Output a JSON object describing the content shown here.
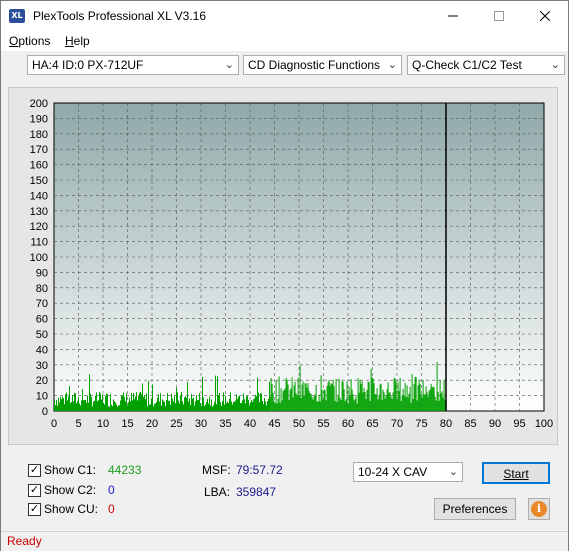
{
  "window": {
    "title": "PlexTools Professional XL V3.16",
    "icon_text": "XL",
    "minimize_icon": "minimize-icon",
    "maximize_icon": "maximize-icon",
    "close_icon": "close-icon"
  },
  "menu": {
    "options_prefix": "O",
    "options_rest": "ptions",
    "help_prefix": "H",
    "help_rest": "elp"
  },
  "toolbar": {
    "drive": "HA:4 ID:0  PX-712UF",
    "function": "CD Diagnostic Functions",
    "test": "Q-Check C1/C2 Test"
  },
  "chart_data": {
    "type": "bar",
    "y_ticks": [
      200,
      190,
      180,
      170,
      160,
      150,
      140,
      130,
      120,
      110,
      100,
      90,
      80,
      70,
      60,
      50,
      40,
      30,
      20,
      10,
      0
    ],
    "x_ticks": [
      0,
      5,
      10,
      15,
      20,
      25,
      30,
      35,
      40,
      45,
      50,
      55,
      60,
      65,
      70,
      75,
      80,
      85,
      90,
      95,
      100
    ],
    "xlim": [
      0,
      100
    ],
    "ylim": [
      0,
      200
    ],
    "grid": true,
    "series": [
      {
        "color": "#00a000",
        "x_range": [
          0,
          80
        ],
        "segments": [
          {
            "from": 0,
            "to": 44,
            "typical": 9,
            "peak": 25
          },
          {
            "from": 44,
            "to": 80,
            "typical": 16,
            "peak": 34
          }
        ]
      }
    ],
    "end_marker_x": 80,
    "colors": {
      "plot_top": "#8fa8a8",
      "plot_bottom": "#ffffff",
      "bar": "#00a000"
    }
  },
  "stats": {
    "show_c1_label": "Show C1:",
    "c1_value": "44233",
    "show_c2_label": "Show C2:",
    "c2_value": "0",
    "show_cu_label": "Show CU:",
    "cu_value": "0",
    "msf_label": "MSF:",
    "msf_value": "79:57.72",
    "lba_label": "LBA:",
    "lba_value": "359847"
  },
  "controls": {
    "speed": "10-24 X CAV",
    "start_label": "Start",
    "preferences_label": "Preferences",
    "info_icon_text": "i"
  },
  "status": {
    "text": "Ready"
  }
}
